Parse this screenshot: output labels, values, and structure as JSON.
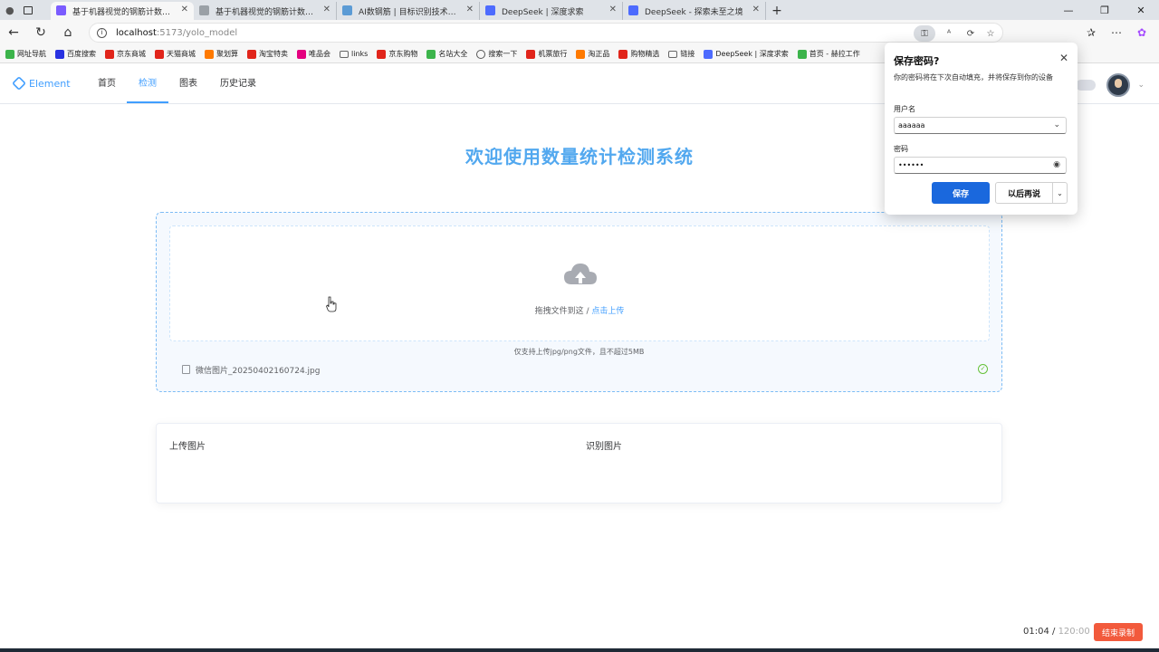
{
  "browser": {
    "tabs": [
      {
        "title": "基于机器视觉的钢筋计数系统算法",
        "active": true,
        "favicon_color": "#7b5cff"
      },
      {
        "title": "基于机器视觉的钢筋计数系统算法",
        "active": false,
        "favicon_color": "#9aa0a6"
      },
      {
        "title": "AI数钢筋 | 目标识别技术在钢筋计",
        "active": false,
        "favicon_color": "#5b9bd5"
      },
      {
        "title": "DeepSeek | 深度求索",
        "active": false,
        "favicon_color": "#4d6bfe"
      },
      {
        "title": "DeepSeek - 探索未至之境",
        "active": false,
        "favicon_color": "#4d6bfe"
      }
    ],
    "url_host": "localhost",
    "url_path": ":5173/yolo_model",
    "bookmarks": [
      {
        "label": "网址导航",
        "color": "#3cb44b"
      },
      {
        "label": "百度搜索",
        "color": "#2932e1"
      },
      {
        "label": "京东商城",
        "color": "#e1251b"
      },
      {
        "label": "天猫商城",
        "color": "#e1251b"
      },
      {
        "label": "聚划算",
        "color": "#ff7a00"
      },
      {
        "label": "淘宝特卖",
        "color": "#e1251b"
      },
      {
        "label": "唯品会",
        "color": "#e4007f"
      },
      {
        "label": "links",
        "color": "#666666"
      },
      {
        "label": "京东购物",
        "color": "#e1251b"
      },
      {
        "label": "名站大全",
        "color": "#3cb44b"
      },
      {
        "label": "搜索一下",
        "color": "#555555"
      },
      {
        "label": "机票旅行",
        "color": "#e1251b"
      },
      {
        "label": "淘正品",
        "color": "#ff7a00"
      },
      {
        "label": "购物精选",
        "color": "#e1251b"
      },
      {
        "label": "链接",
        "color": "#666666"
      },
      {
        "label": "DeepSeek | 深度求索",
        "color": "#4d6bfe"
      },
      {
        "label": "首页 - 赫拉工作",
        "color": "#3cb44b"
      }
    ]
  },
  "app": {
    "logo": "Element",
    "menu": [
      {
        "label": "首页",
        "active": false
      },
      {
        "label": "检测",
        "active": true
      },
      {
        "label": "图表",
        "active": false
      },
      {
        "label": "历史记录",
        "active": false
      }
    ],
    "accent_color": "#409eff"
  },
  "main": {
    "title": "欢迎使用数量统计检测系统",
    "upload": {
      "drag_text": "拖拽文件到这 / ",
      "click_text": "点击上传",
      "tip": "仅支持上传jpg/png文件，且不超过5MB",
      "file_name": "微信图片_20250402160724.jpg"
    },
    "result": {
      "upload_label": "上传图片",
      "recognized_label": "识别图片"
    }
  },
  "password_popup": {
    "title": "保存密码?",
    "description": "你的密码将在下次自动填充，并将保存到你的设备",
    "username_label": "用户名",
    "username_value": "aaaaaa",
    "password_label": "密码",
    "password_value": "••••••",
    "save_label": "保存",
    "later_label": "以后再说"
  },
  "recorder": {
    "elapsed": "01:04",
    "separator": " / ",
    "total": "120:00",
    "stop_label": "结束录制"
  }
}
